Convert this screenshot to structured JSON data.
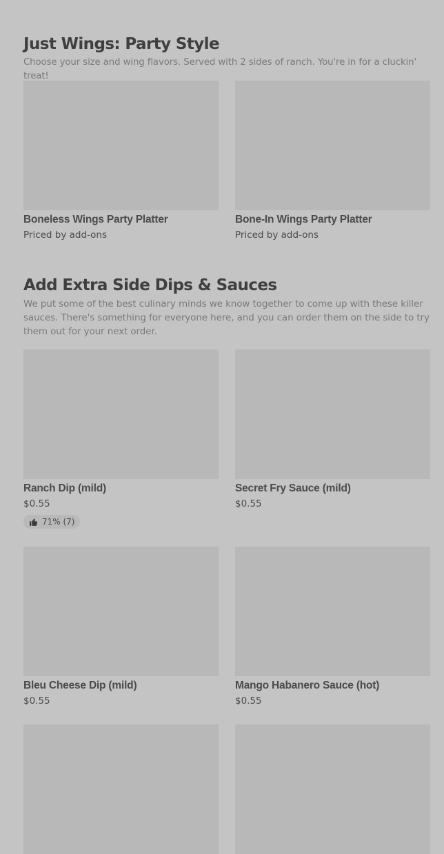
{
  "sections": [
    {
      "title": "Just Wings: Party Style",
      "description": "Choose your size and wing flavors. Served with 2 sides of ranch. You're in for a cluckin' treat!",
      "items": [
        {
          "name": "Boneless Wings Party Platter",
          "price": "Priced by add-ons"
        },
        {
          "name": "Bone-In Wings Party Platter",
          "price": "Priced by add-ons"
        }
      ]
    },
    {
      "title": "Add Extra Side Dips & Sauces",
      "description": "We put some of the best culinary minds we know together to come up with these killer sauces. There's something for everyone here, and you can order them on the side to try them out for your next order.",
      "items": [
        {
          "name": "Ranch Dip (mild)",
          "price": "$0.55",
          "rating": "71% (7)"
        },
        {
          "name": "Secret Fry Sauce (mild)",
          "price": "$0.55"
        },
        {
          "name": "Bleu Cheese Dip (mild)",
          "price": "$0.55"
        },
        {
          "name": "Mango Habanero Sauce (hot)",
          "price": "$0.55"
        }
      ]
    }
  ],
  "icons": {
    "rating": "thumbs-up-icon"
  }
}
